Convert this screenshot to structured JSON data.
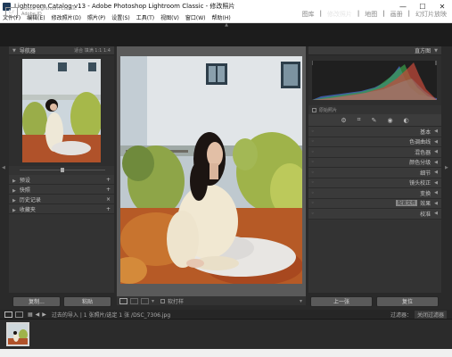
{
  "window": {
    "title": "Lightroom Catalog-v13 - Adobe Photoshop Lightroom Classic - 修改照片",
    "minimize": "—",
    "maximize": "☐",
    "close": "✕"
  },
  "menu": [
    "文件(F)",
    "编辑(E)",
    "修改照片(D)",
    "照片(P)",
    "设置(S)",
    "工具(T)",
    "视图(V)",
    "窗口(W)",
    "帮助(H)"
  ],
  "identity": {
    "logo": "Lr",
    "line1": "Adobe Lightroom Classic",
    "line2": "Adobe ID"
  },
  "modules": [
    "图库",
    "修改照片",
    "地图",
    "画册",
    "幻灯片放映"
  ],
  "active_module": 1,
  "left": {
    "navigator_label": "导航器",
    "navigator_zoom": "适合 填满 1:1 1:4",
    "sections": [
      "预设",
      "快照",
      "历史记录",
      "收藏夹"
    ],
    "copy_button": "复制...",
    "paste_button": "粘贴"
  },
  "right": {
    "histogram_label": "直方图",
    "histogram_info": "原始照片",
    "sections": [
      "基本",
      "色调曲线",
      "混色器",
      "颜色分级",
      "细节",
      "镜头校正",
      "变换",
      "效果",
      "校准"
    ],
    "camera_profile_badge": "配置文件",
    "prev_button": "上一张",
    "reset_button": "复位"
  },
  "toolbar": {
    "label": "软打样"
  },
  "filmbar": {
    "path": "过去的导入 | 1 张照片/选定 1 张 /DSC_7306.jpg",
    "filter_label": "过滤器：",
    "filter_value": "关闭过滤器"
  },
  "colors": {
    "bg": "#2a2a2a",
    "panel": "#333333",
    "active_module": "#e6e6e6",
    "center": "#5a5a5a"
  }
}
